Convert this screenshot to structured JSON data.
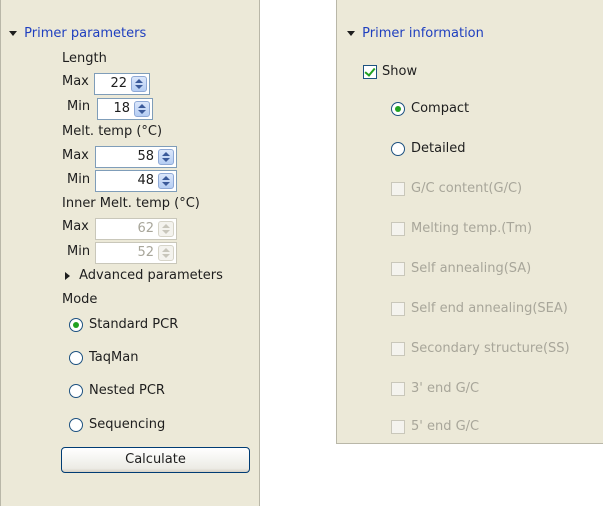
{
  "primer_parameters": {
    "title": "Primer parameters",
    "length": {
      "label": "Length",
      "max_label": "Max",
      "max_value": "22",
      "min_label": "Min",
      "min_value": "18"
    },
    "melt_temp": {
      "label": "Melt. temp (°C)",
      "max_label": "Max",
      "max_value": "58",
      "min_label": "Min",
      "min_value": "48"
    },
    "inner_melt_temp": {
      "label": "Inner Melt. temp (°C)",
      "max_label": "Max",
      "max_value": "62",
      "min_label": "Min",
      "min_value": "52"
    },
    "advanced_label": "Advanced parameters",
    "mode_label": "Mode",
    "modes": [
      {
        "label": "Standard PCR",
        "selected": true
      },
      {
        "label": "TaqMan",
        "selected": false
      },
      {
        "label": "Nested PCR",
        "selected": false
      },
      {
        "label": "Sequencing",
        "selected": false
      }
    ],
    "calculate_label": "Calculate"
  },
  "primer_information": {
    "title": "Primer information",
    "show_label": "Show",
    "show_checked": true,
    "view_options": [
      {
        "label": "Compact",
        "selected": true
      },
      {
        "label": "Detailed",
        "selected": false
      }
    ],
    "fields": [
      {
        "label": "G/C content(G/C)"
      },
      {
        "label": "Melting temp.(Tm)"
      },
      {
        "label": "Self annealing(SA)"
      },
      {
        "label": "Self end annealing(SEA)"
      },
      {
        "label": "Secondary structure(SS)"
      },
      {
        "label": "3' end G/C"
      },
      {
        "label": "5' end G/C"
      }
    ]
  },
  "colors": {
    "panel_bg": "#ece9d8",
    "title_blue": "#1f3fbf",
    "radio_green": "#21a121",
    "disabled_text": "#a8a69a"
  }
}
